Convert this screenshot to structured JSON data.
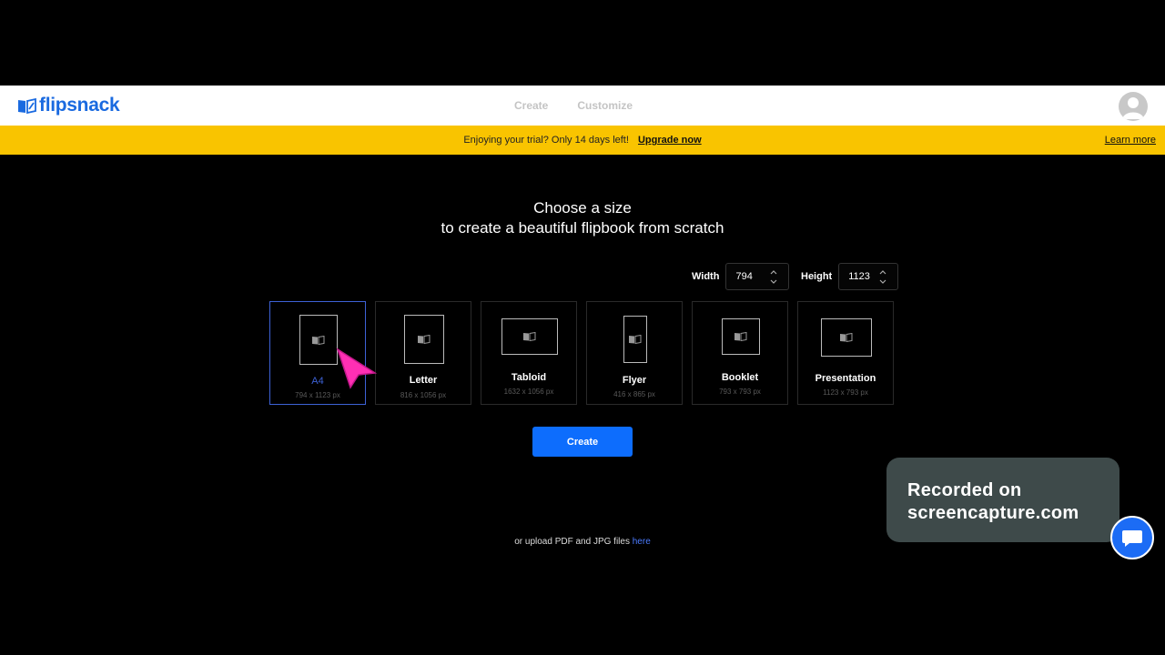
{
  "header": {
    "logo_text": "flipsnack",
    "nav": [
      "Create",
      "Customize"
    ]
  },
  "trial": {
    "message": "Enjoying your trial? Only 14 days left!",
    "upgrade": "Upgrade now",
    "learn_more": "Learn more"
  },
  "main": {
    "title_line1": "Choose a size",
    "title_line2": "to create a beautiful flipbook from scratch",
    "width_label": "Width",
    "width_value": "794",
    "height_label": "Height",
    "height_value": "1123",
    "create_label": "Create",
    "upload_text": "or upload PDF and JPG files",
    "upload_link": "here"
  },
  "sizes": [
    {
      "label": "A4",
      "dims": "794 x 1123 px",
      "selected": true
    },
    {
      "label": "Letter",
      "dims": "816 x 1056 px",
      "selected": false
    },
    {
      "label": "Tabloid",
      "dims": "1632 x 1056 px",
      "selected": false
    },
    {
      "label": "Flyer",
      "dims": "416 x 865 px",
      "selected": false
    },
    {
      "label": "Booklet",
      "dims": "793 x 793 px",
      "selected": false
    },
    {
      "label": "Presentation",
      "dims": "1123 x 793 px",
      "selected": false
    }
  ],
  "watermark": {
    "line1": "Recorded on",
    "line2": "screencapture.com"
  },
  "colors": {
    "brand_blue": "#1a6ae0",
    "trial_yellow": "#f9c400",
    "create_blue": "#0d6dfd",
    "selected_blue": "#3d62d6",
    "cursor_pink": "#ff2fb4"
  },
  "icons": {
    "logo": "flipsnack-book-icon",
    "avatar": "user-avatar-icon",
    "chat": "chat-bubble-icon",
    "cursor": "pointer-cursor-icon"
  }
}
